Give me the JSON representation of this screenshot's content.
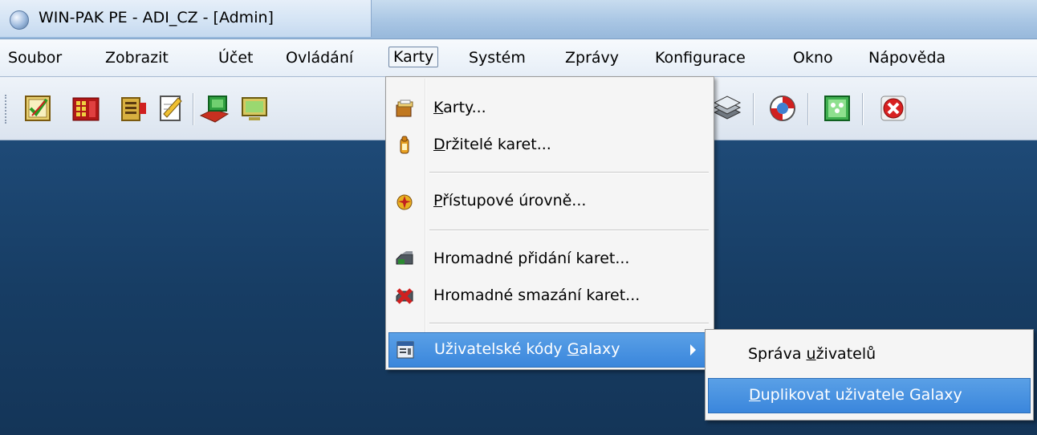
{
  "window": {
    "title": "WIN-PAK PE - ADI_CZ - [Admin]"
  },
  "menubar": {
    "items": [
      {
        "label": "Soubor"
      },
      {
        "label": "Zobrazit"
      },
      {
        "label": "Účet"
      },
      {
        "label": "Ovládání"
      },
      {
        "label": "Karty"
      },
      {
        "label": "Systém"
      },
      {
        "label": "Zprávy"
      },
      {
        "label": "Konfigurace"
      },
      {
        "label": "Okno"
      },
      {
        "label": "Nápověda"
      }
    ]
  },
  "toolbar": {
    "buttons": [
      {
        "icon": "check-card-icon",
        "color": "#3b9a2e"
      },
      {
        "icon": "door-panel-icon",
        "color": "#c02020"
      },
      {
        "icon": "reader-panel-icon",
        "color": "#d8a020"
      },
      {
        "icon": "edit-note-icon",
        "color": "#d8c040"
      },
      {
        "icon": "map-icon",
        "color": "#3aa040"
      },
      {
        "icon": "monitor-icon",
        "color": "#c0b040"
      },
      {
        "icon": "layers-icon",
        "color": "#808890"
      },
      {
        "icon": "lifebuoy-icon",
        "color": "#d03030"
      },
      {
        "icon": "users-screen-icon",
        "color": "#40a050"
      },
      {
        "icon": "exit-icon",
        "color": "#d02020"
      }
    ]
  },
  "dropdown": {
    "items": [
      {
        "pre": "",
        "key": "K",
        "post": "arty...",
        "icon": "cards-icon"
      },
      {
        "pre": "",
        "key": "D",
        "post": "ržitelé karet...",
        "icon": "cardholder-icon"
      },
      {
        "pre": "",
        "key": "P",
        "post": "řístupové úrovně...",
        "icon": "access-level-icon"
      },
      {
        "pre": "Hromadné přidání karet...",
        "key": "",
        "post": "",
        "icon": "batch-add-icon"
      },
      {
        "pre": "Hromadné smazání karet...",
        "key": "",
        "post": "",
        "icon": "batch-delete-icon"
      },
      {
        "pre": "Uživatelské kódy ",
        "key": "G",
        "post": "alaxy",
        "icon": "galaxy-codes-icon"
      }
    ]
  },
  "submenu": {
    "items": [
      {
        "pre": "Správa ",
        "key": "u",
        "post": "živatelů"
      },
      {
        "pre": "",
        "key": "D",
        "post": "uplikovat uživatele Galaxy"
      }
    ]
  },
  "colors": {
    "highlight": "#3a86dc",
    "desktop": "#173d64"
  }
}
